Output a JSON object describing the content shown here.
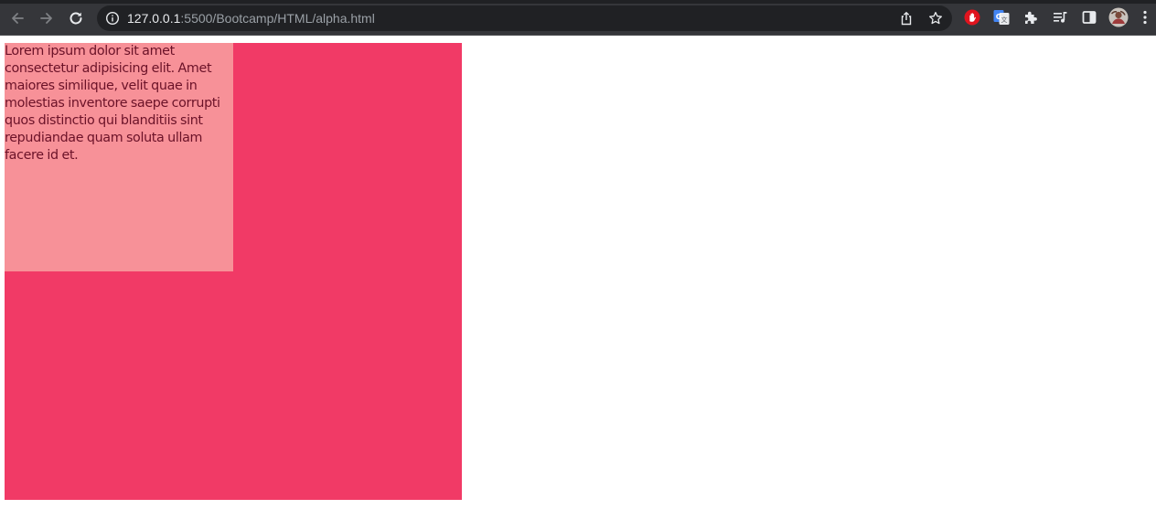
{
  "browser": {
    "url_host": "127.0.0.1",
    "url_rest": ":5500/Bootcamp/HTML/alpha.html",
    "icons": {
      "back": "arrow-left-icon",
      "forward": "arrow-right-icon",
      "reload": "reload-icon",
      "site_info": "info-icon",
      "share": "share-icon",
      "bookmark": "star-icon",
      "extension_adblock": "hand-stop-icon",
      "extension_translate": "google-translate-icon",
      "extensions": "puzzle-icon",
      "reading_list": "reading-list-icon",
      "side_panel": "side-panel-icon",
      "profile": "avatar",
      "menu": "kebab-menu-icon"
    }
  },
  "page": {
    "paragraph": "Lorem ipsum dolor sit amet consectetur adipisicing elit. Amet maiores similique, velit quae in molestias inventore saepe corrupti quos distinctio qui blanditiis sint repudiandae quam soluta ullam facere id et.",
    "colors": {
      "outer_box": "#f13a66",
      "inner_box": "#f79198",
      "text": "#6b1228"
    }
  }
}
